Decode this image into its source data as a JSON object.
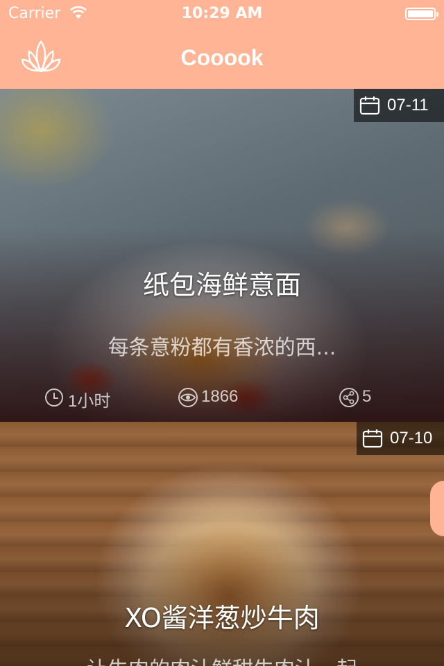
{
  "status_bar": {
    "carrier": "Carrier",
    "time": "10:29 AM"
  },
  "nav": {
    "title": "Cooook",
    "logo_icon": "lotus-logo-icon"
  },
  "theme": {
    "accent": "#ffb595",
    "text_on_image": "#ffffff"
  },
  "recipes": [
    {
      "date": "07-11",
      "title": "纸包海鲜意面",
      "description": "每条意粉都有香浓的西...",
      "cook_time": "1小时",
      "views": "1866",
      "shares": "5"
    },
    {
      "date": "07-10",
      "title": "XO酱洋葱炒牛肉",
      "description": "让牛肉的肉汁鲜甜牛肉汁一起"
    }
  ]
}
